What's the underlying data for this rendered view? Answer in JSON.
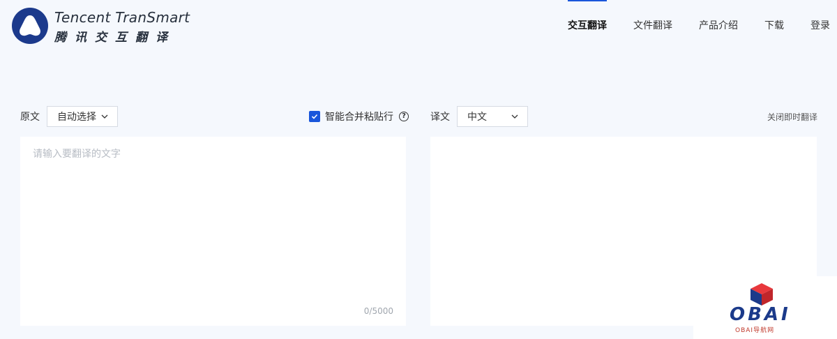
{
  "brand": {
    "name_en": "Tencent TranSmart",
    "name_cn": "腾讯交互翻译"
  },
  "nav": {
    "items": [
      {
        "label": "交互翻译",
        "active": true
      },
      {
        "label": "文件翻译",
        "active": false
      },
      {
        "label": "产品介绍",
        "active": false
      },
      {
        "label": "下载",
        "active": false
      },
      {
        "label": "登录",
        "active": false
      }
    ]
  },
  "source": {
    "label": "原文",
    "language": "自动选择",
    "placeholder": "请输入要翻译的文字",
    "counter": "0/5000"
  },
  "smart_merge": {
    "label": "智能合并粘贴行",
    "checked": true
  },
  "target": {
    "label": "译文",
    "language": "中文",
    "realtime_toggle": "关闭即时翻译"
  },
  "watermark": {
    "text": "OBAI",
    "sub": "OBAI导航网"
  },
  "colors": {
    "accent": "#1a56db",
    "background": "#f5f8fd",
    "logo": "#1c3a8c"
  },
  "icons": {
    "help": "?"
  }
}
